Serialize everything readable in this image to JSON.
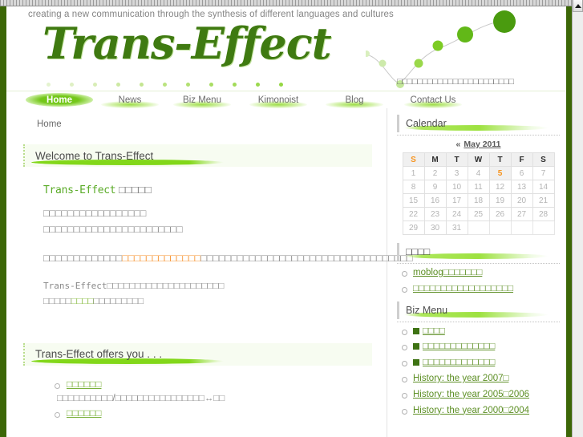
{
  "browser": {
    "scroll_up_icon": "triangle-up-icon"
  },
  "header": {
    "tagline": "creating a new communication through the synthesis of different languages and cultures",
    "logo": "Trans-Effect",
    "jp_subtitle": "□□□□□□□□□□□□□□□□□□□□□□□"
  },
  "nav": {
    "items": [
      {
        "label": "Home",
        "active": true
      },
      {
        "label": "News",
        "active": false
      },
      {
        "label": "Biz Menu",
        "active": false
      },
      {
        "label": "Kimonoist",
        "active": false
      },
      {
        "label": "Blog",
        "active": false
      },
      {
        "label": "Contact Us",
        "active": false
      }
    ]
  },
  "breadcrumb": "Home",
  "main": {
    "welcome": {
      "heading": "Welcome to Trans-Effect",
      "lead_brand": "Trans-Effect",
      "lead_rest": " □□□□□",
      "para1_line1": "□□□□□□□□□□□□□□□□□",
      "para1_line2": "□□□□□□□□□□□□□□□□□□□□□□□",
      "para2_pre": "□□□□□□□□□□□□□",
      "para2_orange": "□□□□□□□□□□□□□",
      "para2_post": "□□□□□□□□□□□□□□□□□□□□□□□□□□□□□□□□□□□",
      "para3_brand": "Trans-Effect",
      "para3_pre": "□□□□□□□□□□□□□□□□□□□□□",
      "para3_mid": "□□□□□",
      "para3_green": "□□□□",
      "para3_post": "□□□□□□□□□"
    },
    "offers": {
      "heading": "Trans-Effect offers you . . .",
      "items": [
        {
          "title": "□□□□□□",
          "desc": "□□□□□□□□□□/□□□□□□□□□□□□□□□□↔□□"
        },
        {
          "title": "□□□□□□",
          "desc": ""
        }
      ]
    }
  },
  "sidebar": {
    "calendar": {
      "title": "Calendar",
      "prev_label": "«",
      "month_label": "May 2011",
      "day_headers": [
        "S",
        "M",
        "T",
        "W",
        "T",
        "F",
        "S"
      ],
      "weeks": [
        [
          "1",
          "2",
          "3",
          "4",
          "5",
          "6",
          "7"
        ],
        [
          "8",
          "9",
          "10",
          "11",
          "12",
          "13",
          "14"
        ],
        [
          "15",
          "16",
          "17",
          "18",
          "19",
          "20",
          "21"
        ],
        [
          "22",
          "23",
          "24",
          "25",
          "26",
          "27",
          "28"
        ],
        [
          "29",
          "30",
          "31",
          "",
          "",
          "",
          ""
        ]
      ],
      "today": "5"
    },
    "links_widget": {
      "title": "□□□□",
      "items": [
        "moblog□□□□□□□",
        "□□□□□□□□□□□□□□□□□□"
      ]
    },
    "biz_widget": {
      "title": "Biz Menu",
      "items": [
        {
          "marker": true,
          "label": "□□□□"
        },
        {
          "marker": true,
          "label": "□□□□□□□□□□□□□"
        },
        {
          "marker": true,
          "label": "□□□□□□□□□□□□□"
        },
        {
          "marker": false,
          "label": "History: the year 2007□"
        },
        {
          "marker": false,
          "label": "History: the year 2005□2006"
        },
        {
          "marker": false,
          "label": "History: the year 2000□2004"
        }
      ]
    }
  },
  "colors": {
    "frame_green": "#3c6707",
    "accent_green": "#82d719",
    "logo_green": "#3f7a11",
    "link_green": "#5d8f25",
    "orange": "#f79331"
  }
}
